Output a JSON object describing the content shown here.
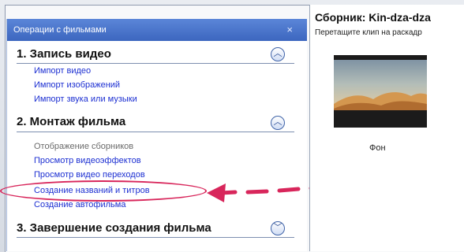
{
  "collection": {
    "title": "Сборник: Kin-dza-dza",
    "hint": "Перетащите клип на раскадр",
    "clip_label": "Фон"
  },
  "taskpane": {
    "header": "Операции с фильмами",
    "close_glyph": "×",
    "sections": [
      {
        "title": "1. Запись видео",
        "links": [
          "Импорт видео",
          "Импорт изображений",
          "Импорт звука или музыки"
        ]
      },
      {
        "title": "2. Монтаж фильма",
        "links": [
          "Отображение сборников",
          "Просмотр видеоэффектов",
          "Просмотр видео переходов",
          "Создание названий и титров",
          "Создание автофильма"
        ]
      },
      {
        "title": "3. Завершение создания фильма",
        "links": []
      }
    ]
  },
  "annotation": {
    "highlighted_item": "Создание названий и титров",
    "color": "#d8265b"
  },
  "colors": {
    "header_blue": "#3c66bf",
    "link_blue": "#1c2fd2",
    "disabled_gray": "#6b6b6b"
  },
  "icons": {
    "collapse": "chevron-up-icon",
    "expand": "chevron-down-icon",
    "close": "close-icon"
  }
}
